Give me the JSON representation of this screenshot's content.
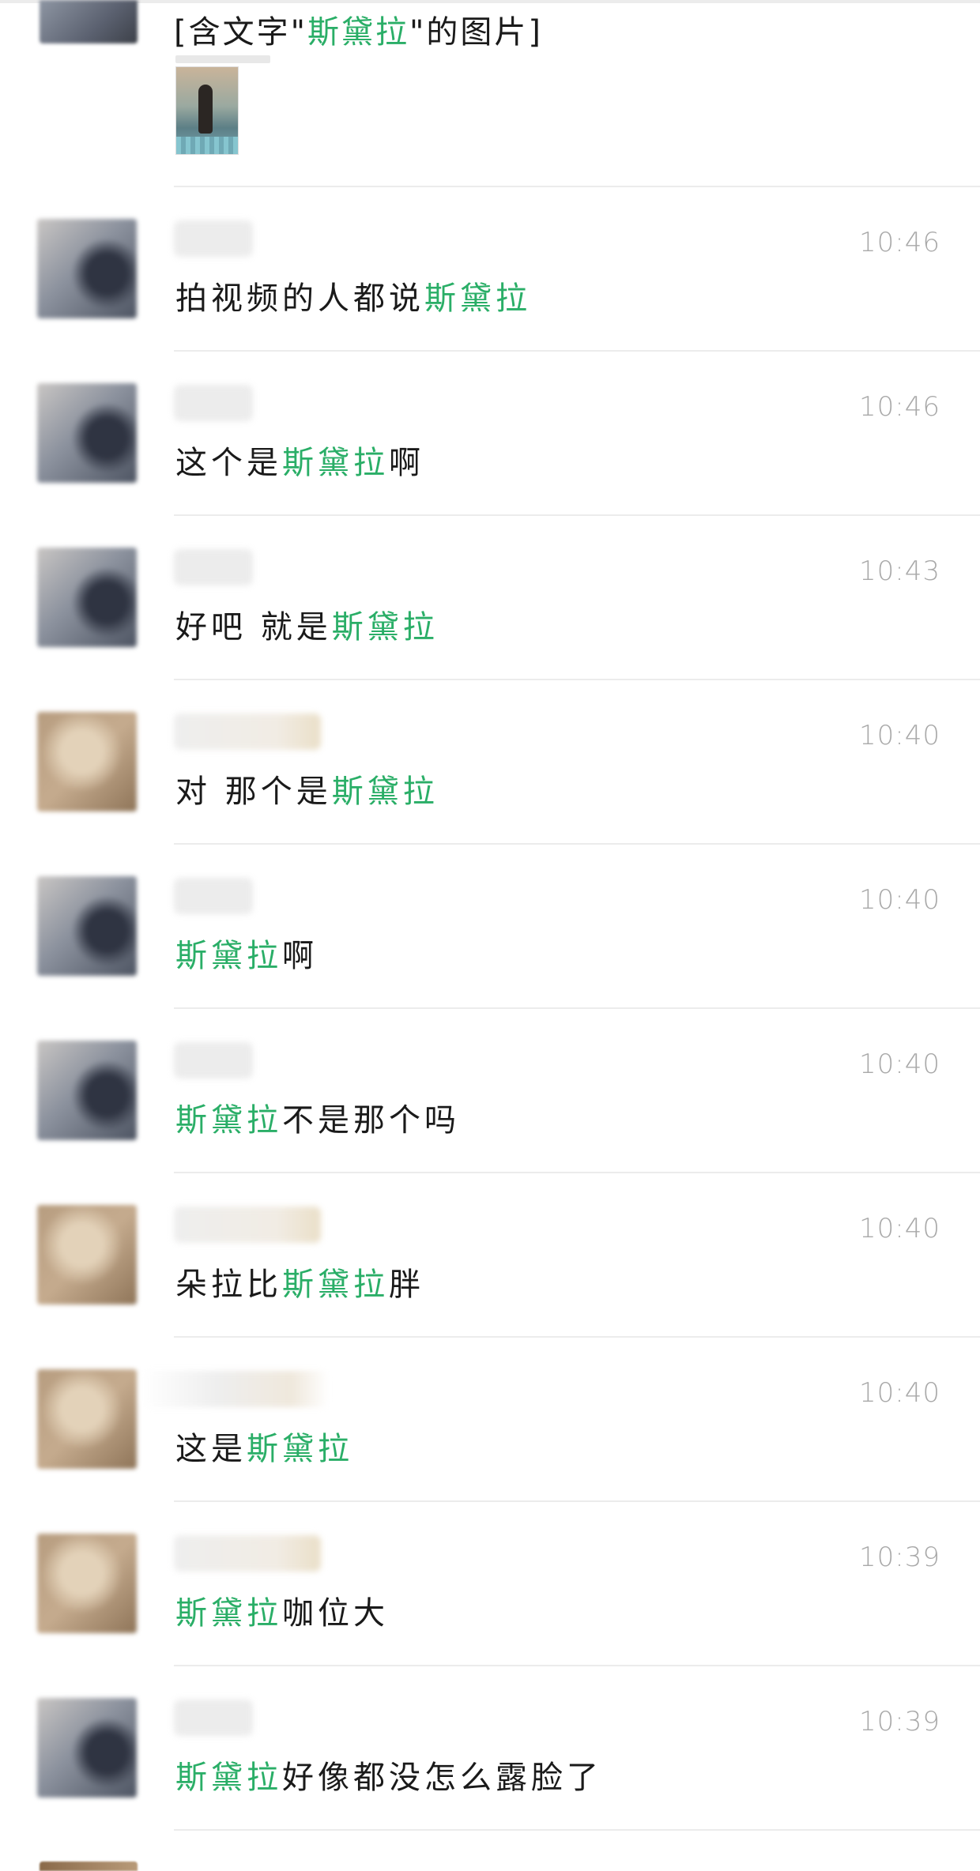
{
  "highlight_color": "#2aae67",
  "first_result": {
    "prefix": "[含文字\"",
    "keyword": "斯黛拉",
    "suffix": "\"的图片]"
  },
  "results": [
    {
      "time": "10:46",
      "pre": "拍视频的人都说",
      "kw": "斯黛拉",
      "post": ""
    },
    {
      "time": "10:46",
      "pre": "这个是",
      "kw": "斯黛拉",
      "post": "啊"
    },
    {
      "time": "10:43",
      "pre": "好吧 就是",
      "kw": "斯黛拉",
      "post": ""
    },
    {
      "time": "10:40",
      "pre": "对 那个是",
      "kw": "斯黛拉",
      "post": ""
    },
    {
      "time": "10:40",
      "pre": "",
      "kw": "斯黛拉",
      "post": "啊"
    },
    {
      "time": "10:40",
      "pre": "",
      "kw": "斯黛拉",
      "post": "不是那个吗"
    },
    {
      "time": "10:40",
      "pre": "朵拉比",
      "kw": "斯黛拉",
      "post": "胖"
    },
    {
      "time": "10:40",
      "pre": "这是",
      "kw": "斯黛拉",
      "post": ""
    },
    {
      "time": "10:39",
      "pre": "",
      "kw": "斯黛拉",
      "post": "咖位大"
    },
    {
      "time": "10:39",
      "pre": "",
      "kw": "斯黛拉",
      "post": "好像都没怎么露脸了"
    }
  ]
}
